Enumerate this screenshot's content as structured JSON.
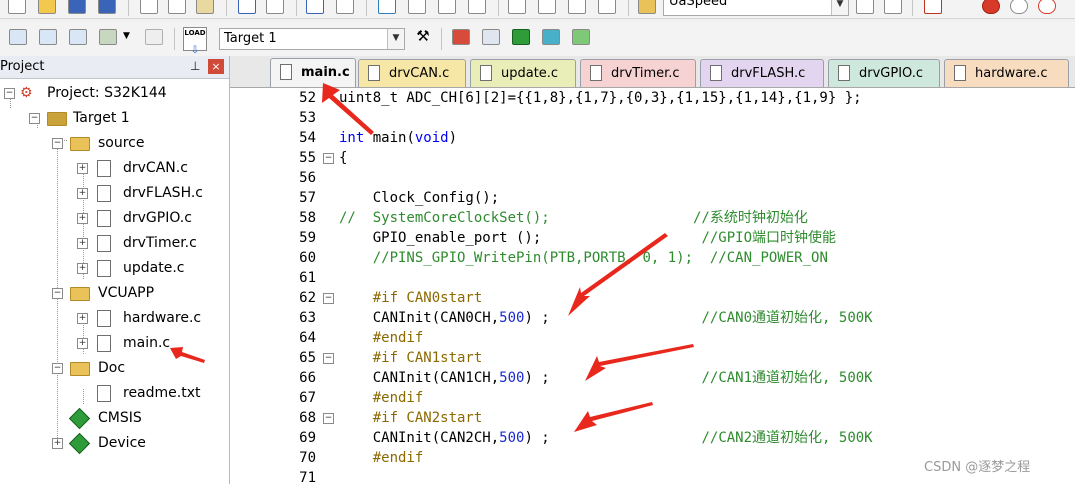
{
  "toolbar_top": {
    "target_combo": "UaSpeed"
  },
  "toolbar_build": {
    "load_label": "LOAD",
    "target_select": "Target 1"
  },
  "project_panel": {
    "title": "Project",
    "pin_icon": "⊥",
    "close_label": "×",
    "tree": [
      {
        "label": "Project: S32K144",
        "icon": "project-icon"
      },
      {
        "label": "Target 1",
        "icon": "target-icon"
      },
      {
        "label": "source",
        "icon": "folder-icon"
      },
      {
        "label": "drvCAN.c",
        "icon": "file-icon"
      },
      {
        "label": "drvFLASH.c",
        "icon": "file-icon"
      },
      {
        "label": "drvGPIO.c",
        "icon": "file-icon"
      },
      {
        "label": "drvTimer.c",
        "icon": "file-icon"
      },
      {
        "label": "update.c",
        "icon": "file-icon"
      },
      {
        "label": "VCUAPP",
        "icon": "folder-icon"
      },
      {
        "label": "hardware.c",
        "icon": "file-icon"
      },
      {
        "label": "main.c",
        "icon": "file-icon"
      },
      {
        "label": "Doc",
        "icon": "folder-icon"
      },
      {
        "label": "readme.txt",
        "icon": "file-icon"
      },
      {
        "label": "CMSIS",
        "icon": "component-icon"
      },
      {
        "label": "Device",
        "icon": "component-icon"
      }
    ]
  },
  "tabs": [
    {
      "label": "main.c",
      "color": "#f4f4f4",
      "active": true
    },
    {
      "label": "drvCAN.c",
      "color": "#f7e7a6"
    },
    {
      "label": "update.c",
      "color": "#e9edb8"
    },
    {
      "label": "drvTimer.c",
      "color": "#f6d2d2"
    },
    {
      "label": "drvFLASH.c",
      "color": "#e3d4ef"
    },
    {
      "label": "drvGPIO.c",
      "color": "#cfe8de"
    },
    {
      "label": "hardware.c",
      "color": "#f7dcc0"
    }
  ],
  "editor": {
    "lines": [
      {
        "n": "52",
        "text": "uint8_t ADC_CH[6][2]={{1,8},{1,7},{0,3},{1,15},{1,14},{1,9} };"
      },
      {
        "n": "53",
        "text": ""
      },
      {
        "n": "54",
        "text": "int main(void)"
      },
      {
        "n": "55",
        "text": "{"
      },
      {
        "n": "56",
        "text": ""
      },
      {
        "n": "57",
        "text": "    Clock_Config();"
      },
      {
        "n": "58",
        "text": "//  SystemCoreClockSet();                 //系统时钟初始化"
      },
      {
        "n": "59",
        "text": "    GPIO_enable_port ();                   //GPIO端口时钟使能"
      },
      {
        "n": "60",
        "text": "    //PINS_GPIO_WritePin(PTB,PORTB, 0, 1);  //CAN_POWER_ON"
      },
      {
        "n": "61",
        "text": ""
      },
      {
        "n": "62",
        "text": "    #if CAN0start"
      },
      {
        "n": "63",
        "text": "    CANInit(CAN0CH,500) ;                  //CAN0通道初始化, 500K"
      },
      {
        "n": "64",
        "text": "    #endif"
      },
      {
        "n": "65",
        "text": "    #if CAN1start"
      },
      {
        "n": "66",
        "text": "    CANInit(CAN1CH,500) ;                  //CAN1通道初始化, 500K"
      },
      {
        "n": "67",
        "text": "    #endif"
      },
      {
        "n": "68",
        "text": "    #if CAN2start"
      },
      {
        "n": "69",
        "text": "    CANInit(CAN2CH,500) ;                  //CAN2通道初始化, 500K"
      },
      {
        "n": "70",
        "text": "    #endif"
      },
      {
        "n": "71",
        "text": ""
      }
    ],
    "fold_markers": [
      "55",
      "62",
      "65",
      "68"
    ]
  },
  "watermark": "CSDN @逐梦之程",
  "colors": {
    "keyword": "#0000ff",
    "comment": "#2e8b2e",
    "preprocessor": "#8a6a00",
    "arrow": "#e8281c"
  }
}
